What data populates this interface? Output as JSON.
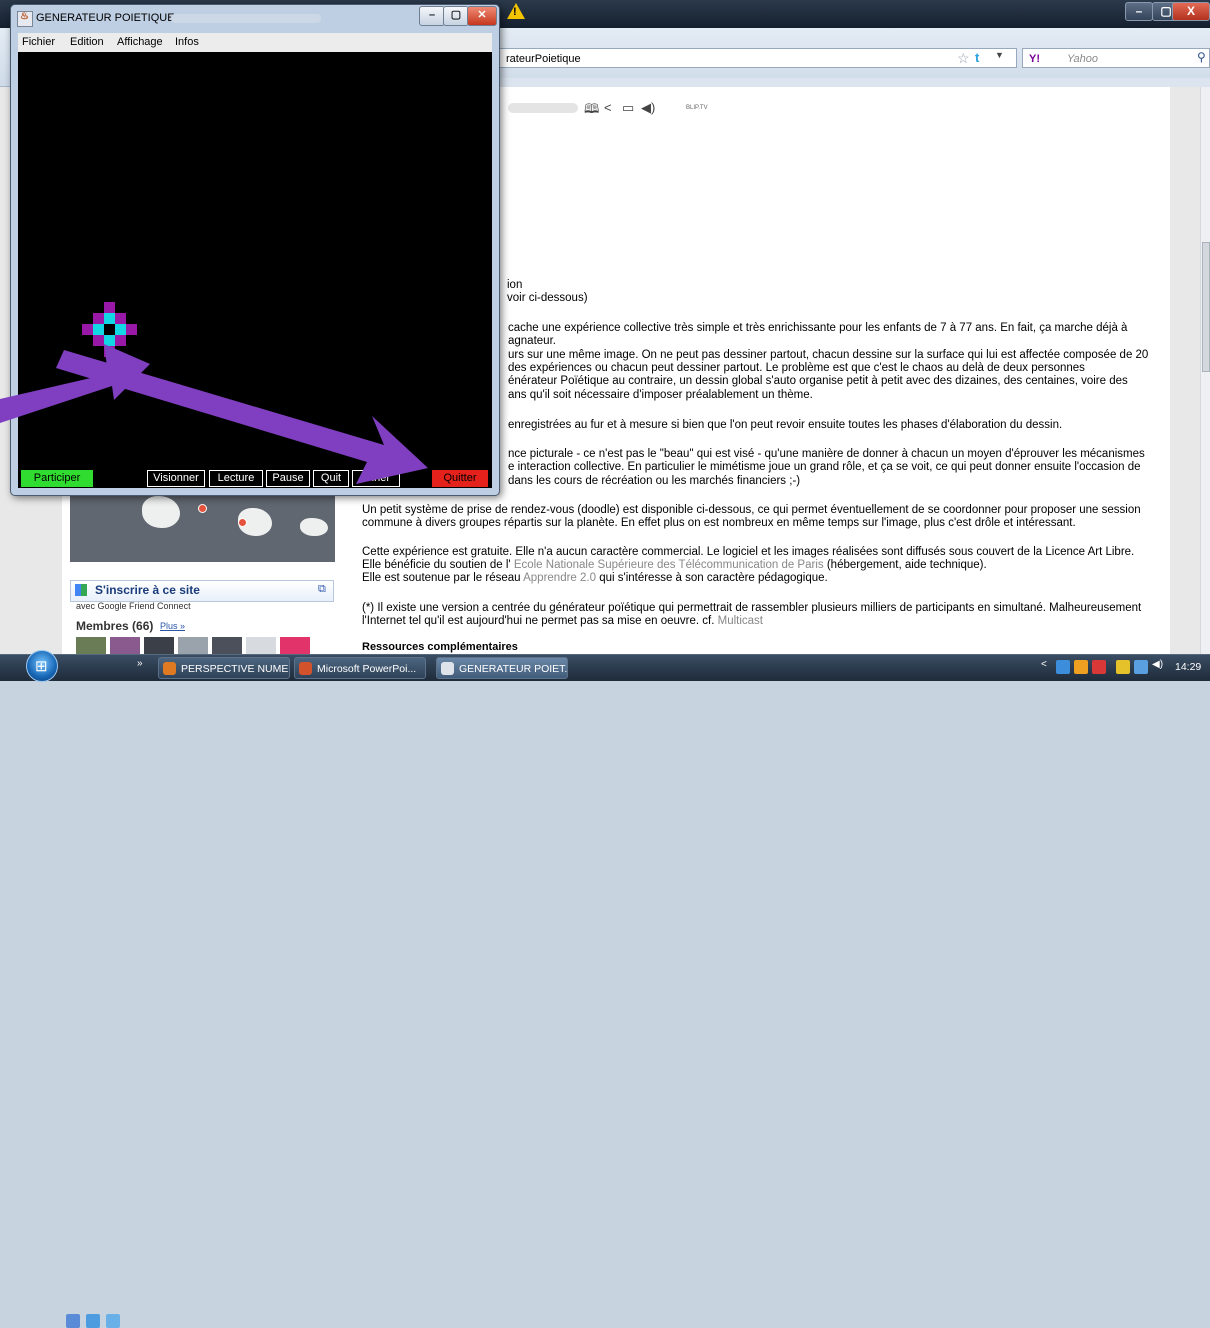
{
  "browser": {
    "close_label": "X",
    "url_text": "rateurPoietique",
    "search_logo": "Y!",
    "search_placeholder": "Yahoo",
    "player_brand": "BLIP.TV"
  },
  "page": {
    "frag1": "ion",
    "frag2": "voir ci-dessous)",
    "p1_l1": "cache une expérience collective très simple et très enrichissante pour les enfants de 7 à 77 ans. En fait, ça marche déjà à",
    "p1_l2": "agnateur.",
    "p1_l3": "urs sur une même image. On ne peut pas dessiner partout, chacun dessine sur la surface qui lui est affectée composée de 20",
    "p1_l4": "des expériences ou chacun peut dessiner partout. Le problème est que c'est le chaos au delà de deux personnes",
    "p1_l5": "énérateur Poïétique au contraire, un dessin global s'auto organise petit à petit avec des dizaines, des centaines, voire des",
    "p1_l6": "ans qu'il soit nécessaire d'imposer préalablement un thème.",
    "p2": "enregistrées au fur et à mesure si bien que l'on peut revoir ensuite toutes les phases d'élaboration du dessin.",
    "p3_l1": "nce picturale - ce n'est pas le \"beau\" qui est visé - qu'une manière de donner à chacun un moyen d'éprouver les mécanismes",
    "p3_l2": "e interaction collective. En particulier le mimétisme joue un grand rôle, et ça se voit, ce qui peut donner ensuite l'occasion de",
    "p3_l3": "dans les cours de récréation ou les marchés financiers ;-)",
    "p4_l1": "Un petit système de prise de rendez-vous (doodle) est disponible ci-dessous, ce qui permet éventuellement de se coordonner pour proposer une session",
    "p4_l2": "commune à divers groupes répartis sur la planète. En effet plus on est nombreux en même temps sur l'image, plus c'est drôle et intéressant.",
    "p5_l1": "Cette expérience est gratuite. Elle n'a aucun caractère commercial. Le logiciel et les images réalisées sont diffusés sous couvert de la Licence Art Libre.",
    "p5_l2a": "Elle bénéficie du soutien de l'",
    "p5_l2link": "Ecole Nationale Supérieure des Télécommunication de Paris",
    "p5_l2b": "(hébergement, aide technique).",
    "p5_l3a": "Elle est soutenue par le réseau",
    "p5_l3link": "Apprendre 2.0",
    "p5_l3b": "qui s'intéresse à son caractère pédagogique.",
    "p6_l1": "(*) Il existe une version a centrée du générateur poïétique qui permettrait de rassembler plusieurs milliers de participants en simultané. Malheureusement",
    "p6_l2a": "l'Internet tel qu'il est aujourd'hui ne permet pas sa mise en oeuvre. cf.",
    "p6_l2link": "Multicast",
    "heading": "Ressources complémentaires"
  },
  "sidebar": {
    "gfc_label": "S'inscrire à ce site",
    "gfc_sub": "avec Google Friend Connect",
    "members": "Membres (66)",
    "more": "Plus »"
  },
  "gp_window": {
    "title": "GENERATEUR POIETIQUE",
    "menu": [
      "Fichier",
      "Edition",
      "Affichage",
      "Infos"
    ],
    "buttons": {
      "participer": "Participer",
      "visionner": "Visionner",
      "lecture": "Lecture",
      "pause": "Pause",
      "quit_partial": "Quit",
      "visionner_partial": "onner",
      "quitter": "Quitter"
    }
  },
  "taskbar": {
    "tasks": [
      "PERSPECTIVE NUME...",
      "Microsoft PowerPoi...",
      "GENERATEUR POIET..."
    ],
    "clock": "14:29",
    "chevron": "»"
  },
  "colors": {
    "accent_purple": "#7f3fc0",
    "participer_green": "#2fdc2f",
    "quitter_red": "#e4221b",
    "pixel_magenta": "#9a18a8",
    "pixel_cyan": "#12d8e6"
  }
}
